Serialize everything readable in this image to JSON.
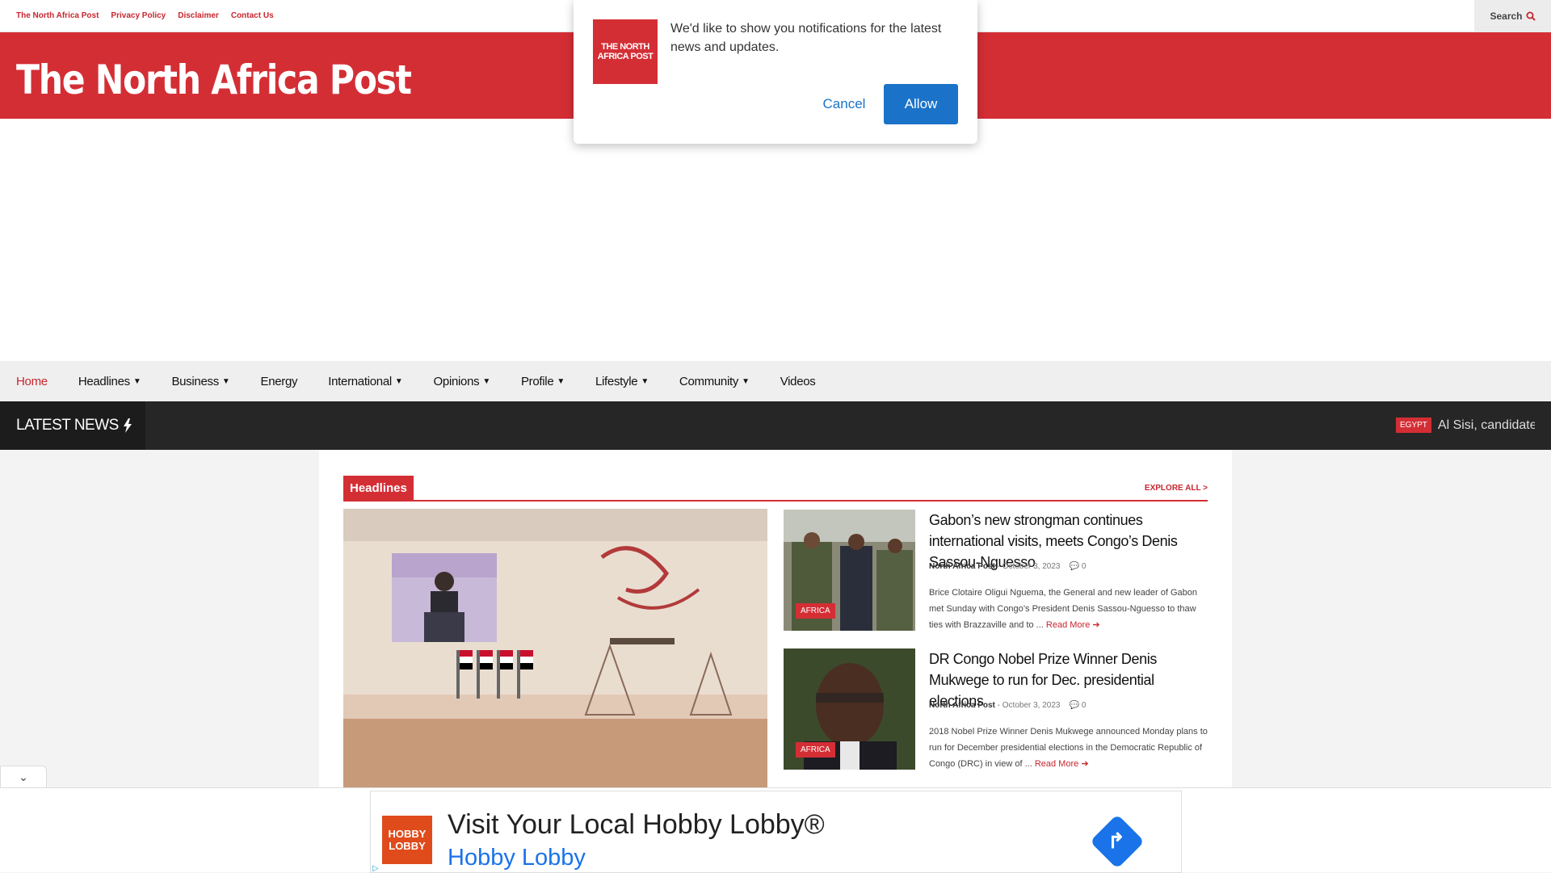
{
  "topbar": {
    "links": [
      "The North Africa Post",
      "Privacy Policy",
      "Disclaimer",
      "Contact Us"
    ],
    "search_label": "Search",
    "search_icon": "search-icon"
  },
  "brand": {
    "title": "The North Africa Post"
  },
  "nav": {
    "items": [
      {
        "label": "Home",
        "active": true,
        "dropdown": false
      },
      {
        "label": "Headlines",
        "dropdown": true
      },
      {
        "label": "Business",
        "dropdown": true
      },
      {
        "label": "Energy",
        "dropdown": false
      },
      {
        "label": "International",
        "dropdown": true
      },
      {
        "label": "Opinions",
        "dropdown": true
      },
      {
        "label": "Profile",
        "dropdown": true
      },
      {
        "label": "Lifestyle",
        "dropdown": true
      },
      {
        "label": "Community",
        "dropdown": true
      },
      {
        "label": "Videos",
        "dropdown": false
      }
    ]
  },
  "ticker": {
    "label": "LATEST NEWS",
    "category": "EGYPT",
    "text": "Al Sisi, candidate"
  },
  "section": {
    "title": "Headlines",
    "explore": "EXPLORE ALL >"
  },
  "posts": [
    {
      "category": "AFRICA",
      "title": "Gabon’s new strongman continues international visits, meets Congo’s Denis Sassou-Nguesso",
      "author": "North Africa Post",
      "date": "- October 3, 2023",
      "comments": "0",
      "excerpt": "Brice Clotaire Oligui Nguema, the General and new leader of Gabon met Sunday with Congo’s President Denis Sassou-Nguesso to thaw ties with Brazzaville and to ...",
      "read_more": "Read More"
    },
    {
      "category": "AFRICA",
      "title": "DR Congo Nobel Prize Winner Denis Mukwege to run for Dec. presidential elections",
      "author": "North Africa Post",
      "date": "- October 3, 2023",
      "comments": "0",
      "excerpt": "2018 Nobel Prize Winner Denis Mukwege announced Monday plans to run for December presidential elections in the Democratic Republic of Congo (DRC) in view of ...",
      "read_more": "Read More"
    }
  ],
  "push_prompt": {
    "logo_text": "THE NORTH AFRICA POST",
    "message": "We'd like to show you notifications for the latest news and updates.",
    "cancel": "Cancel",
    "allow": "Allow"
  },
  "bottom_ad": {
    "logo_text": "HOBBY LOBBY",
    "title": "Visit Your Local Hobby Lobby®",
    "subtitle": "Hobby Lobby"
  },
  "colors": {
    "brand_red": "#d42e35",
    "accent_blue": "#1a73c8"
  }
}
